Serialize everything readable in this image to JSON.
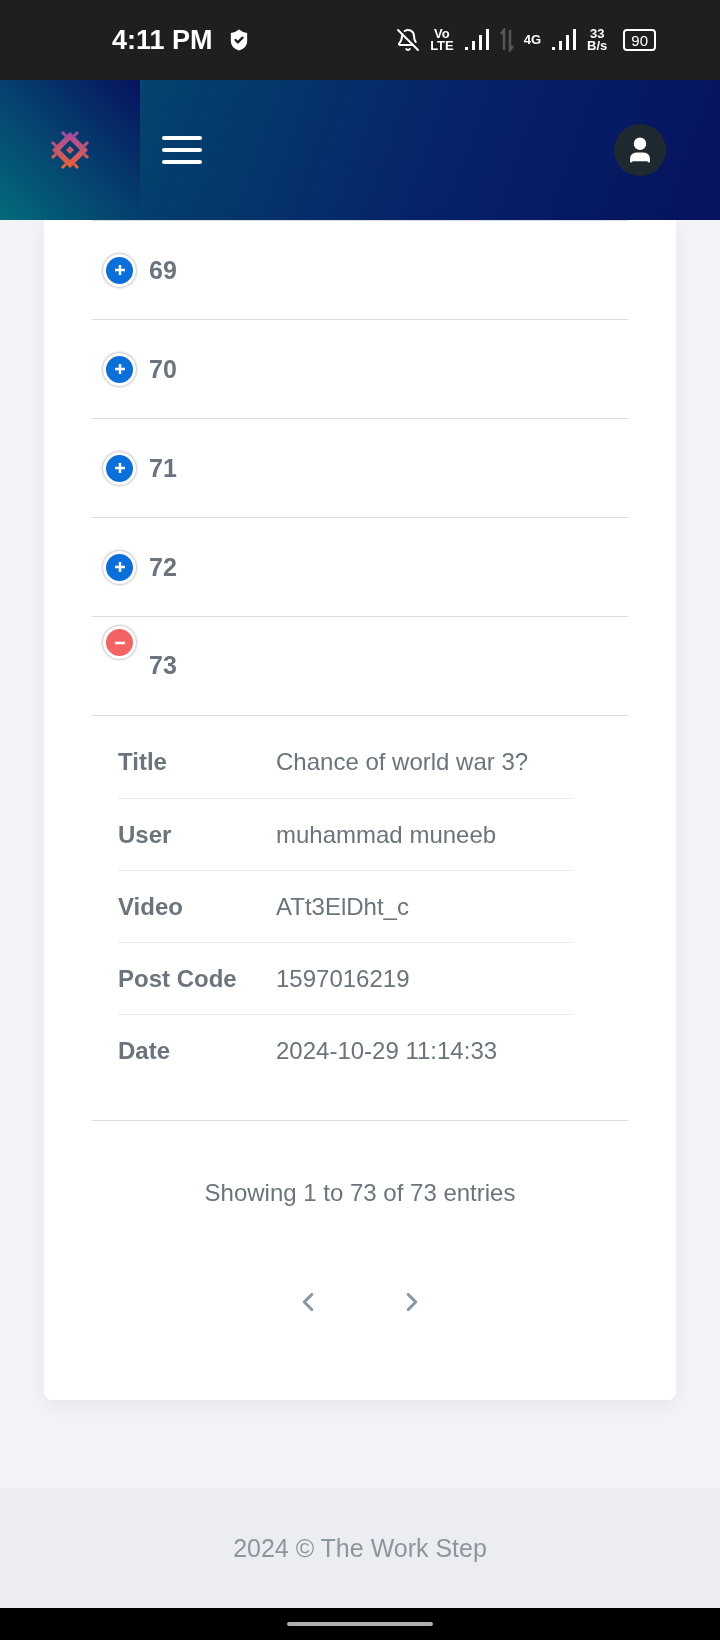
{
  "status_bar": {
    "time": "4:11 PM",
    "volte_top": "Vo",
    "volte_bottom": "LTE",
    "network": "4G",
    "speed_value": "33",
    "speed_unit": "B/s",
    "battery": "90"
  },
  "rows": [
    {
      "number": "69",
      "expanded": false
    },
    {
      "number": "70",
      "expanded": false
    },
    {
      "number": "71",
      "expanded": false
    },
    {
      "number": "72",
      "expanded": false
    },
    {
      "number": "73",
      "expanded": true,
      "details": [
        {
          "label": "Title",
          "value": "Chance of world war 3?"
        },
        {
          "label": "User",
          "value": "muhammad muneeb"
        },
        {
          "label": "Video",
          "value": "ATt3ElDht_c"
        },
        {
          "label": "Post Code",
          "value": "1597016219"
        },
        {
          "label": "Date",
          "value": "2024-10-29 11:14:33"
        }
      ]
    }
  ],
  "info": "Showing 1 to 73 of 73 entries",
  "footer": "2024 © The Work Step"
}
